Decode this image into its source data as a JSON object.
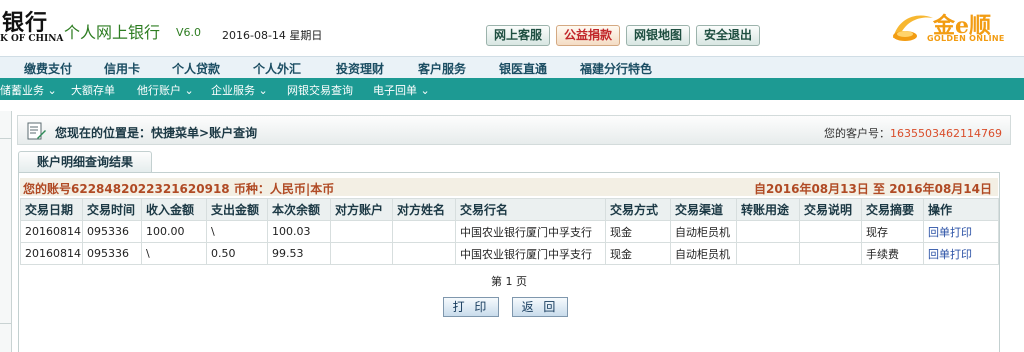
{
  "header": {
    "logo_main": "银行",
    "logo_sub": "K OF CHINA",
    "app_title": "个人网上银行",
    "app_version": "V6.0",
    "date": "2016-08-14 星期日",
    "buttons": [
      "网上客服",
      "公益捐款",
      "网银地图",
      "安全退出"
    ],
    "brand_cn": "金e顺",
    "brand_en": "GOLDEN ONLINE"
  },
  "menu_primary": [
    "缴费支付",
    "信用卡",
    "个人贷款",
    "个人外汇",
    "投资理财",
    "客户服务",
    "银医直通",
    "福建分行特色"
  ],
  "menu_secondary": [
    "储蓄业务 ⌄",
    "大额存单",
    "他行账户 ⌄",
    "企业服务 ⌄",
    "网银交易查询",
    "电子回单 ⌄"
  ],
  "location": {
    "prefix": "您现在的位置是：",
    "path": "快捷菜单>账户查询",
    "customer_label": "您的客户号：",
    "customer_no": "1635503462114769"
  },
  "result": {
    "tab_title": "账户明细查询结果",
    "account_line": "您的账号6228482022321620918 币种：人民币|本币",
    "date_range": "自2016年08月13日  至  2016年08月14日",
    "columns": [
      "交易日期",
      "交易时间",
      "收入金额",
      "支出金额",
      "本次余额",
      "对方账户",
      "对方姓名",
      "交易行名",
      "交易方式",
      "交易渠道",
      "转账用途",
      "交易说明",
      "交易摘要",
      "操作"
    ],
    "rows": [
      [
        "20160814",
        "095336",
        "100.00",
        "\\",
        "100.03",
        "",
        "",
        "中国农业银行厦门中孚支行",
        "现金",
        "自动柜员机",
        "",
        "",
        "现存",
        "回单打印"
      ],
      [
        "20160814",
        "095336",
        "\\",
        "0.50",
        "99.53",
        "",
        "",
        "中国农业银行厦门中孚支行",
        "现金",
        "自动柜员机",
        "",
        "",
        "手续费",
        "回单打印"
      ]
    ],
    "pager": "第 1 页",
    "print_label": "打 印",
    "back_label": "返 回"
  },
  "colors": {
    "accent_green": "#2e7d22",
    "menu_teal": "#1d9a93",
    "brand_orange": "#f29c12",
    "account_text": "#b04a24",
    "link_blue": "#2b52a6"
  }
}
